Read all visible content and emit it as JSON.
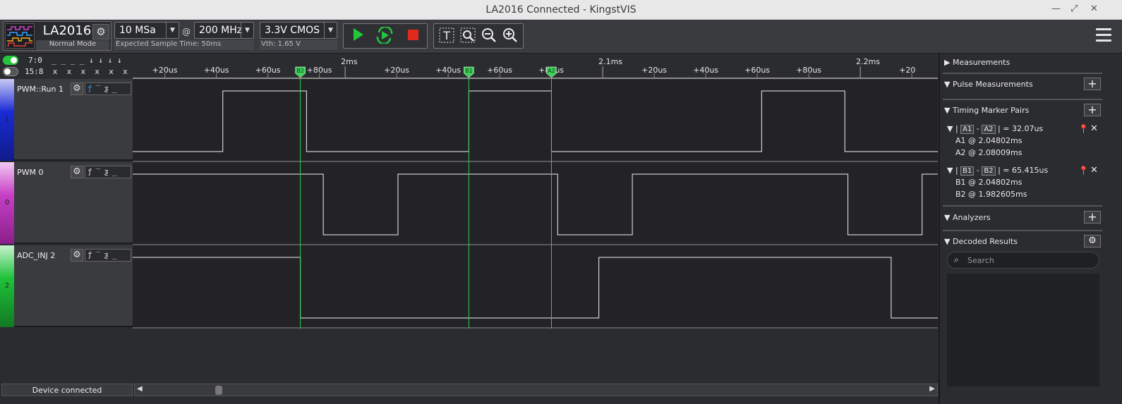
{
  "window": {
    "title": "LA2016 Connected - KingstVIS",
    "min": "—",
    "max": "⤢",
    "close": "✕"
  },
  "device": {
    "name": "LA2016",
    "mode": "Normal Mode"
  },
  "sampling": {
    "samples": "10 MSa",
    "at": "@",
    "rate": "200 MHz",
    "expected": "Expected Sample Time: 50ms"
  },
  "threshold": {
    "voltage": "3.3V CMOS",
    "vth": "Vth:  1.65 V"
  },
  "channel_header": {
    "row1": "7:0  _ _ _ _ ↓ ↓ ↓ ↓",
    "row2": "15:8  x  x  x  x  x  x  x  x"
  },
  "time_ruler": {
    "major": [
      {
        "t": 2.0,
        "label": "2ms"
      },
      {
        "t": 2.1,
        "label": "2.1ms"
      },
      {
        "t": 2.2,
        "label": "2.2ms"
      }
    ],
    "minor": [
      {
        "t": 1.93,
        "label": "+20us"
      },
      {
        "t": 1.95,
        "label": "+40us"
      },
      {
        "t": 1.97,
        "label": "+60us"
      },
      {
        "t": 1.99,
        "label": "+80us"
      },
      {
        "t": 2.02,
        "label": "+20us"
      },
      {
        "t": 2.04,
        "label": "+40us"
      },
      {
        "t": 2.06,
        "label": "+60us"
      },
      {
        "t": 2.08,
        "label": "+80us"
      },
      {
        "t": 2.12,
        "label": "+20us"
      },
      {
        "t": 2.14,
        "label": "+40us"
      },
      {
        "t": 2.16,
        "label": "+60us"
      },
      {
        "t": 2.18,
        "label": "+80us"
      },
      {
        "t": 2.22,
        "label": "+20"
      }
    ]
  },
  "markers": [
    {
      "label": "B2",
      "t": 1.982605
    },
    {
      "label": "B1",
      "t": 2.04802
    },
    {
      "label": "A2",
      "t": 2.08009
    }
  ],
  "channels": [
    {
      "name": "PWM::Run 1",
      "num": "1",
      "color": "#1a2bd6",
      "trigger": "ƒ‾ƺ_",
      "edges": [
        1.9525,
        1.985,
        2.04802,
        2.08009,
        2.1617,
        2.194
      ],
      "start": 0
    },
    {
      "name": "PWM 0",
      "num": "0",
      "color": "#c640c6",
      "trigger": "ƒ‾ƺ_",
      "edges": [
        1.9915,
        2.0205,
        2.0825,
        2.1115,
        2.1952,
        2.224
      ],
      "start": 1
    },
    {
      "name": "ADC_INJ 2",
      "num": "2",
      "color": "#1fc23a",
      "trigger": "ƒ‾ƺ_",
      "edges": [
        1.982605,
        2.0985,
        2.212
      ],
      "start": 1
    }
  ],
  "status": {
    "device": "Device connected"
  },
  "panel": {
    "measurements": "Measurements",
    "pulse": "Pulse Measurements",
    "timing": "Timing Marker Pairs",
    "pair1": {
      "a": "A1",
      "b": "A2",
      "dt": "| = 32.07us",
      "l1": "A1 @ 2.04802ms",
      "l2": "A2 @ 2.08009ms"
    },
    "pair2": {
      "a": "B1",
      "b": "B2",
      "dt": "| = 65.415us",
      "l1": "B1 @ 2.04802ms",
      "l2": "B2 @ 1.982605ms"
    },
    "analyzers": "Analyzers",
    "decoded": "Decoded Results",
    "search_placeholder": "Search"
  }
}
